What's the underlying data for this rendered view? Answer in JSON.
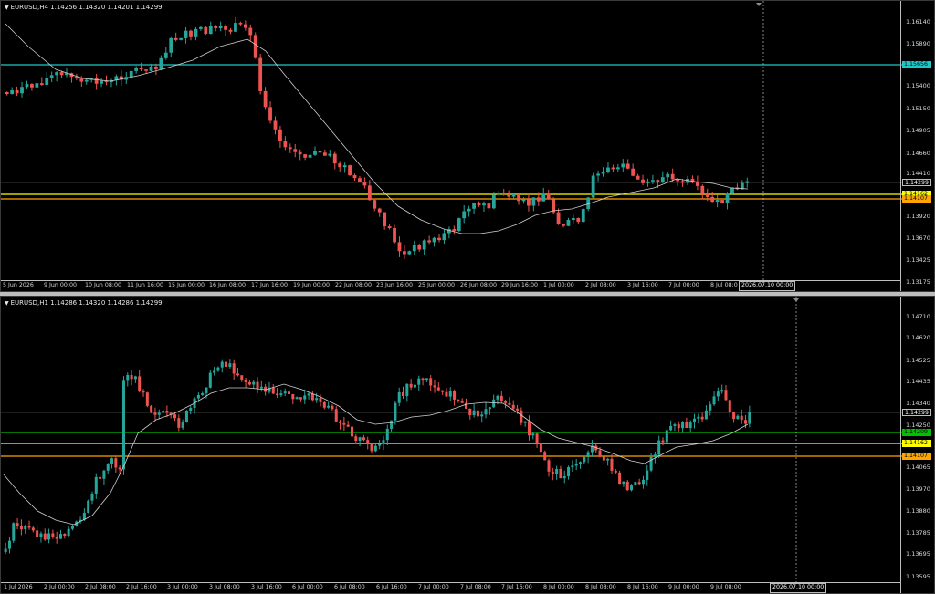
{
  "charts": [
    {
      "title": "EURUSD,H4  1.14256 1.14320 1.14201 1.14299",
      "price_ticks": [
        "1.16140",
        "1.15890",
        "1.15400",
        "1.15150",
        "1.14905",
        "1.14660",
        "1.14410",
        "1.13920",
        "1.13670",
        "1.13425",
        "1.13175"
      ],
      "time_ticks": [
        "5 Jun 2026",
        "9 Jun 00:00",
        "10 Jun 08:00",
        "11 Jun 16:00",
        "15 Jun 00:00",
        "16 Jun 08:00",
        "17 Jun 16:00",
        "19 Jun 00:00",
        "22 Jun 08:00",
        "23 Jun 16:00",
        "25 Jun 00:00",
        "26 Jun 08:00",
        "29 Jun 16:00",
        "1 Jul 00:00",
        "2 Jul 08:00",
        "3 Jul 16:00",
        "7 Jul 00:00",
        "8 Jul 08:0"
      ],
      "cursor_time": "2026.07.10 00:00",
      "tags": [
        {
          "text": "1.15656",
          "color": "#1ec8c8",
          "text_color": "#000"
        },
        {
          "text": "1.14299",
          "color": "#000",
          "text_color": "#ffffff",
          "border": "#bdbdbd"
        },
        {
          "text": "1.14162",
          "color": "#ffff00",
          "text_color": "#000"
        },
        {
          "text": "1.14107",
          "color": "#ffa500",
          "text_color": "#000"
        }
      ]
    },
    {
      "title": "EURUSD,H1  1.14286 1.14320 1.14286 1.14299",
      "price_ticks": [
        "1.14710",
        "1.14620",
        "1.14525",
        "1.14435",
        "1.14340",
        "1.14250",
        "1.14065",
        "1.13970",
        "1.13880",
        "1.13785",
        "1.13695",
        "1.13595"
      ],
      "time_ticks": [
        "1 Jul 2026",
        "2 Jul 00:00",
        "2 Jul 08:00",
        "2 Jul 16:00",
        "3 Jul 00:00",
        "3 Jul 08:00",
        "3 Jul 16:00",
        "6 Jul 00:00",
        "6 Jul 08:00",
        "6 Jul 16:00",
        "7 Jul 00:00",
        "7 Jul 08:00",
        "7 Jul 16:00",
        "8 Jul 00:00",
        "8 Jul 08:00",
        "8 Jul 16:00",
        "9 Jul 00:00",
        "9 Jul 08:00"
      ],
      "cursor_time": "2026.07.10 00:00",
      "tags": [
        {
          "text": "1.14299",
          "color": "#000",
          "text_color": "#ffffff",
          "border": "#bdbdbd"
        },
        {
          "text": "1.14209",
          "color": "#00c000",
          "text_color": "#000"
        },
        {
          "text": "1.14162",
          "color": "#ffff00",
          "text_color": "#000"
        },
        {
          "text": "1.14107",
          "color": "#ffa500",
          "text_color": "#000"
        }
      ]
    }
  ],
  "colors": {
    "bull": "#26a69a",
    "bear": "#ef5350",
    "ma": "#d0d0d0",
    "cyan_line": "#1ec8c8",
    "yellow_line": "#ffff00",
    "orange_line": "#ffa500",
    "green_line": "#00c000"
  }
}
